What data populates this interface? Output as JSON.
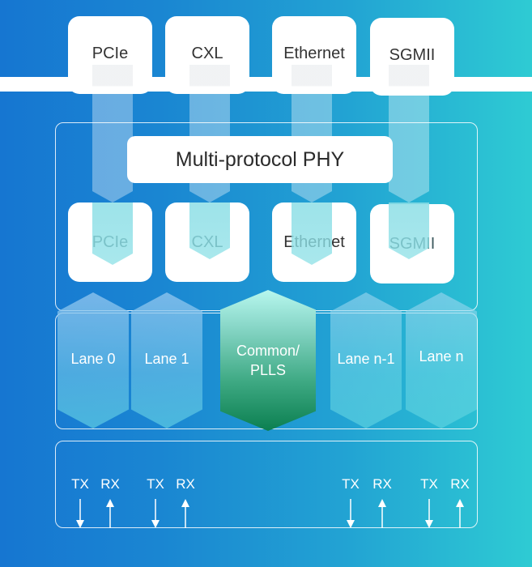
{
  "diagram": {
    "title": "Multi-protocol PHY",
    "protocols_top": [
      "PCIe",
      "CXL",
      "Ethernet",
      "SGMII"
    ],
    "protocols_phy": [
      "PCIe",
      "CXL",
      "Ethernet",
      "SGMII"
    ],
    "lanes": [
      "Lane 0",
      "Lane 1",
      "Lane n-1",
      "Lane n"
    ],
    "common_block": {
      "line1": "Common/",
      "line2": "PLLS"
    },
    "io_signals": [
      {
        "label": "TX",
        "direction": "down"
      },
      {
        "label": "RX",
        "direction": "up"
      },
      {
        "label": "TX",
        "direction": "down"
      },
      {
        "label": "RX",
        "direction": "up"
      },
      {
        "label": "TX",
        "direction": "down"
      },
      {
        "label": "RX",
        "direction": "up"
      },
      {
        "label": "TX",
        "direction": "down"
      },
      {
        "label": "RX",
        "direction": "up"
      }
    ],
    "colors": {
      "background_start": "#1676d1",
      "background_end": "#2ecbd3",
      "card": "#ffffff",
      "common_top": "#b7f7ee",
      "common_bottom": "#0b7f50",
      "text_dark": "#333333",
      "text_light": "#ffffff"
    }
  }
}
